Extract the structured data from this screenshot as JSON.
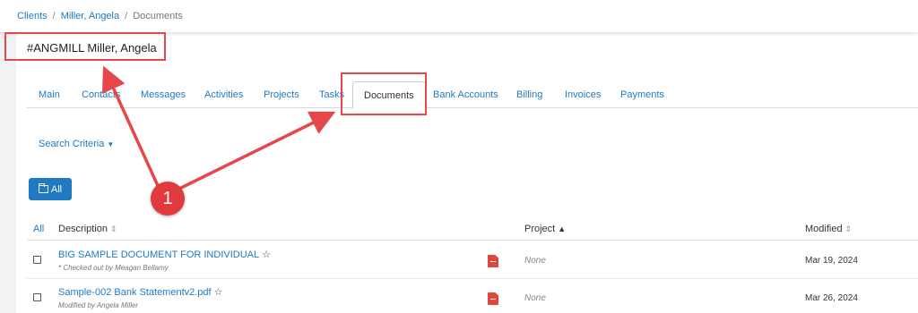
{
  "breadcrumb": {
    "clients": "Clients",
    "client": "Miller, Angela",
    "current": "Documents",
    "separator": "/"
  },
  "client_title": "#ANGMILL Miller, Angela",
  "tabs": [
    "Main",
    "Contacts",
    "Messages",
    "Activities",
    "Projects",
    "Tasks",
    "Documents",
    "Bank Accounts",
    "Billing",
    "Invoices",
    "Payments"
  ],
  "active_tab": "Documents",
  "search_criteria": "Search Criteria",
  "all_button": "All",
  "table": {
    "columns": {
      "all": "All",
      "description": "Description",
      "project": "Project",
      "modified": "Modified"
    },
    "rows": [
      {
        "title": "BIG SAMPLE DOCUMENT FOR INDIVIDUAL",
        "subtitle": "* Checked out by Meagan Bellamy",
        "project": "None",
        "modified": "Mar 19, 2024"
      },
      {
        "title": "Sample-002 Bank Statementv2.pdf",
        "subtitle": "Modified by Angela Miller",
        "project": "None",
        "modified": "Mar 26, 2024"
      }
    ]
  },
  "annotation": {
    "badge_number": "1"
  },
  "colors": {
    "link": "#1f7ac2",
    "annotation": "#e5474b",
    "pdf": "#e0473c",
    "button": "#1f7ac2"
  },
  "icons": {
    "star": "star-icon",
    "folder": "folder-icon",
    "pdf": "pdf-file-icon",
    "sort": "sort-icon"
  }
}
